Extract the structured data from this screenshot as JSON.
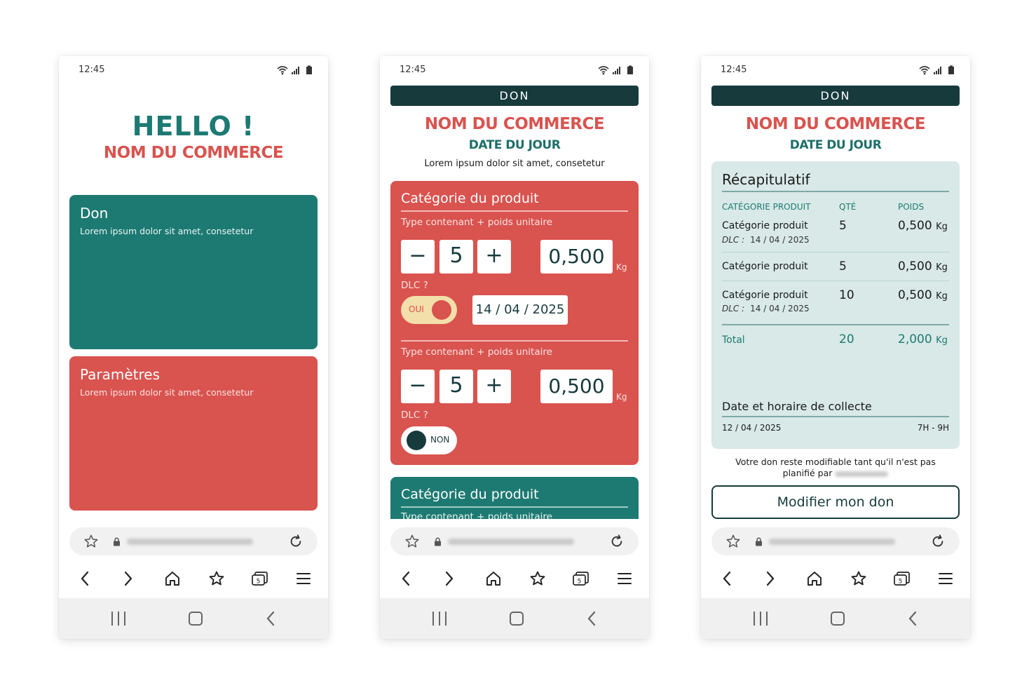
{
  "status_time": "12:45",
  "phone1": {
    "hello": "HELLO !",
    "shop_name": "NOM DU COMMERCE",
    "cards": [
      {
        "title": "Don",
        "subtitle": "Lorem ipsum dolor sit amet, consetetur"
      },
      {
        "title": "Paramètres",
        "subtitle": "Lorem ipsum dolor sit amet, consetetur"
      }
    ]
  },
  "phone2": {
    "header": "DON",
    "shop_name": "NOM DU COMMERCE",
    "date_label": "DATE DU JOUR",
    "lorem": "Lorem ipsum dolor sit amet, consetetur",
    "section1": {
      "title": "Catégorie du produit",
      "items": [
        {
          "sub": "Type contenant + poids unitaire",
          "minus": "−",
          "qty": "5",
          "plus": "+",
          "weight": "0,500",
          "unit": "Kg",
          "dlc_label": "DLC ?",
          "toggle": "OUI",
          "dlc_date": "14 / 04 / 2025"
        },
        {
          "sub": "Type contenant + poids unitaire",
          "minus": "−",
          "qty": "5",
          "plus": "+",
          "weight": "0,500",
          "unit": "Kg",
          "dlc_label": "DLC ?",
          "toggle": "NON"
        }
      ]
    },
    "section2": {
      "title": "Catégorie du produit",
      "sub": "Type contenant + poids unitaire"
    }
  },
  "phone3": {
    "header": "DON",
    "shop_name": "NOM DU COMMERCE",
    "date_label": "DATE DU JOUR",
    "recap": {
      "title": "Récapitulatif",
      "columns": [
        "CATÉGORIE PRODUIT",
        "QTÉ",
        "POIDS"
      ],
      "rows": [
        {
          "category": "Catégorie produit",
          "qty": "5",
          "weight": "0,500",
          "unit": "Kg",
          "dlc_label": "DLC :",
          "dlc": "14 / 04 / 2025"
        },
        {
          "category": "Catégorie produit",
          "qty": "5",
          "weight": "0,500",
          "unit": "Kg"
        },
        {
          "category": "Catégorie produit",
          "qty": "10",
          "weight": "0,500",
          "unit": "Kg",
          "dlc_label": "DLC :",
          "dlc": "14 / 04 / 2025"
        }
      ],
      "total": {
        "label": "Total",
        "qty": "20",
        "weight": "2,000",
        "unit": "Kg"
      },
      "collect_title": "Date et horaire de collecte",
      "collect_date": "12 / 04 / 2025",
      "collect_time": "7H - 9H"
    },
    "notice": "Votre don reste modifiable tant qu'il n'est pas planifié par",
    "modify_button": "Modifier mon don"
  },
  "colors": {
    "teal": "#1d7a72",
    "coral": "#d9534f",
    "dark": "#173a3d",
    "cream": "#f3dfa9",
    "mint": "#d8e9e7"
  }
}
